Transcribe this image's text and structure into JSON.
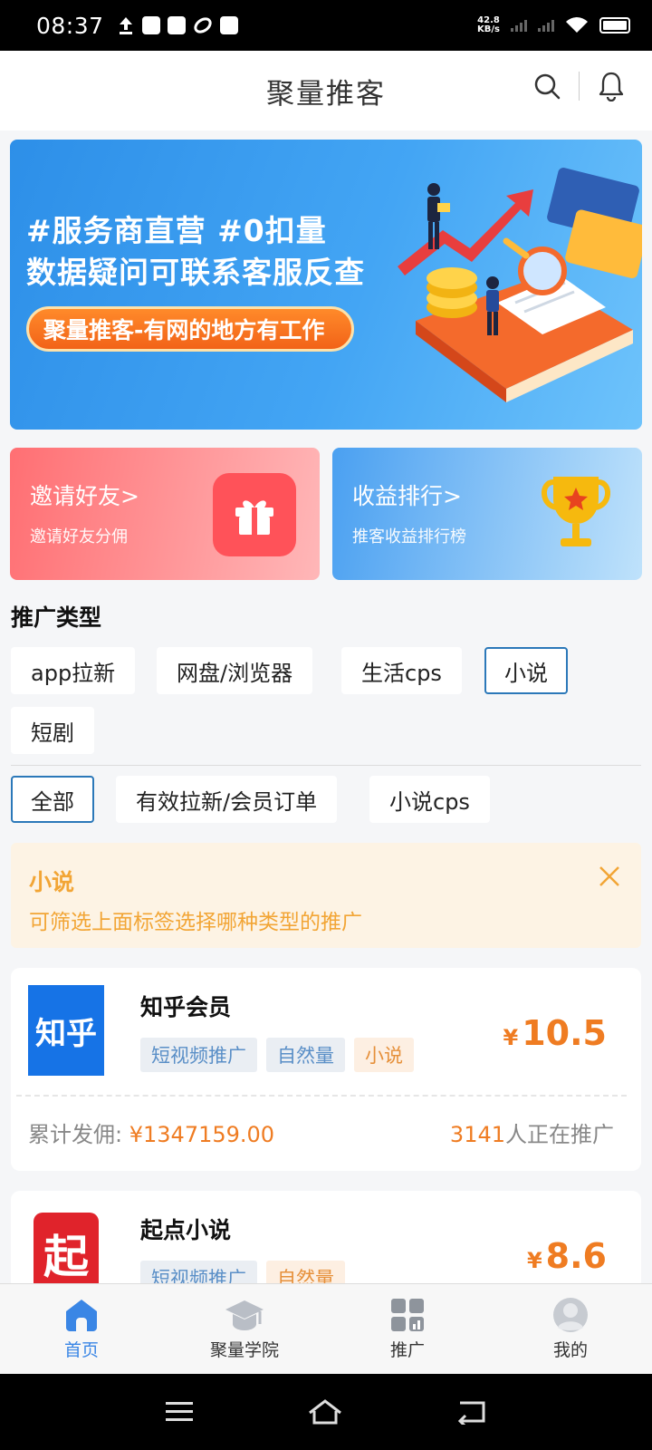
{
  "status_bar": {
    "time": "08:37",
    "net_speed_value": "42.8",
    "net_speed_unit": "KB/s"
  },
  "header": {
    "title": "聚量推客",
    "icons": [
      "search-icon",
      "bell-icon"
    ]
  },
  "banner": {
    "line1": "#服务商直营 #0扣量",
    "line2": "数据疑问可联系客服反查",
    "pill": "聚量推客-有网的地方有工作"
  },
  "quick_cards": {
    "invite": {
      "title": "邀请好友>",
      "subtitle": "邀请好友分佣",
      "icon": "gift-icon"
    },
    "rank": {
      "title": "收益排行>",
      "subtitle": "推客收益排行榜",
      "icon": "trophy-icon"
    }
  },
  "promo_types": {
    "title": "推广类型",
    "items": [
      "app拉新",
      "网盘/浏览器",
      "生活cps",
      "小说",
      "短剧"
    ],
    "selected": "小说"
  },
  "sub_filters": {
    "items": [
      "全部",
      "有效拉新/会员订单",
      "小说cps"
    ],
    "selected": "全部"
  },
  "notice": {
    "title": "小说",
    "text": "可筛选上面标签选择哪种类型的推广"
  },
  "products": [
    {
      "name": "知乎会员",
      "logo_text": "知乎",
      "tags": [
        "短视频推广",
        "自然量",
        "小说"
      ],
      "price_symbol": "¥",
      "price": "10.5",
      "total_label": "累计发佣:",
      "total_symbol": "¥",
      "total_value": "1347159.00",
      "promoters_count": "3141",
      "promoters_suffix": "人正在推广"
    },
    {
      "name": "起点小说",
      "logo_text": "起",
      "tags": [
        "短视频推广",
        "自然量"
      ],
      "price_symbol": "¥",
      "price": "8.6"
    }
  ],
  "tabbar": {
    "items": [
      {
        "label": "首页",
        "icon": "home-icon"
      },
      {
        "label": "聚量学院",
        "icon": "graduation-cap-icon"
      },
      {
        "label": "推广",
        "icon": "grid-icon"
      },
      {
        "label": "我的",
        "icon": "user-icon"
      }
    ],
    "active": "首页"
  },
  "colors": {
    "accent_blue": "#3a86e5",
    "price_orange": "#ef7c22",
    "notice_text": "#f2a535",
    "active_chip_border": "#2b78b9"
  }
}
